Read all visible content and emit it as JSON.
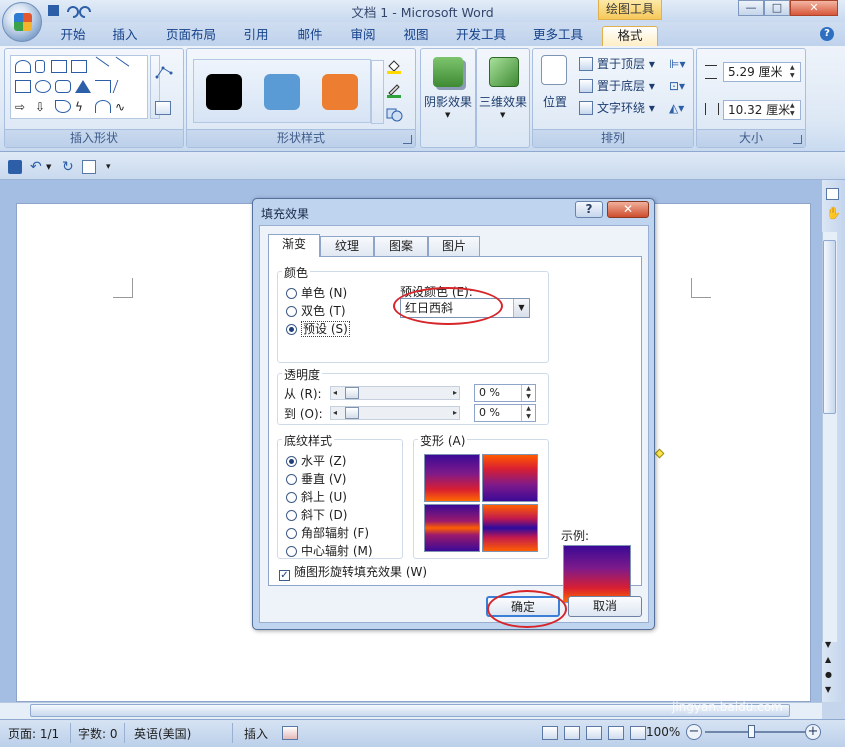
{
  "window": {
    "title": "文档 1 - Microsoft Word",
    "context_tab": "绘图工具",
    "controls": {
      "minimize": "—",
      "maximize": "□",
      "close": "✕"
    }
  },
  "ribbon_tabs": [
    "开始",
    "插入",
    "页面布局",
    "引用",
    "邮件",
    "审阅",
    "视图",
    "开发工具",
    "更多工具",
    "格式"
  ],
  "active_tab": "格式",
  "ribbon": {
    "insert_shapes_label": "插入形状",
    "shape_styles_label": "形状样式",
    "style_swatches": [
      "#000000",
      "#5b9bd5",
      "#ed7d31"
    ],
    "shadow_effect": "阴影效果",
    "three_d_effect": "三维效果",
    "arrange": {
      "label": "排列",
      "position": "位置",
      "bring_to_front": "置于顶层",
      "send_to_back": "置于底层",
      "text_wrap": "文字环绕"
    },
    "size": {
      "label": "大小",
      "height": "5.29 厘米",
      "width": "10.32 厘米"
    }
  },
  "dialog": {
    "title": "填充效果",
    "help": "?",
    "close": "✕",
    "tabs": [
      "渐变",
      "纹理",
      "图案",
      "图片"
    ],
    "color_section": {
      "title": "颜色",
      "options": [
        "单色 (N)",
        "双色 (T)",
        "预设 (S)"
      ],
      "selected": 2,
      "preset_label": "预设颜色 (E):",
      "preset_value": "红日西斜"
    },
    "transparency": {
      "title": "透明度",
      "from_label": "从 (R):",
      "to_label": "到 (O):",
      "from_value": "0 %",
      "to_value": "0 %"
    },
    "shading_styles": {
      "title": "底纹样式",
      "options": [
        "水平 (Z)",
        "垂直 (V)",
        "斜上 (U)",
        "斜下 (D)",
        "角部辐射 (F)",
        "中心辐射 (M)"
      ],
      "selected": 0
    },
    "variants_label": "变形 (A)",
    "sample_label": "示例:",
    "rotate_checkbox": "随图形旋转填充效果 (W)",
    "rotate_checked": true,
    "ok": "确定",
    "cancel": "取消"
  },
  "status": {
    "page": "页面: 1/1",
    "words": "字数: 0",
    "language": "英语(美国)",
    "mode": "插入",
    "zoom": "100%"
  },
  "watermark": {
    "brand": "Bai 经验",
    "url": "jingyan.baidu.com"
  }
}
